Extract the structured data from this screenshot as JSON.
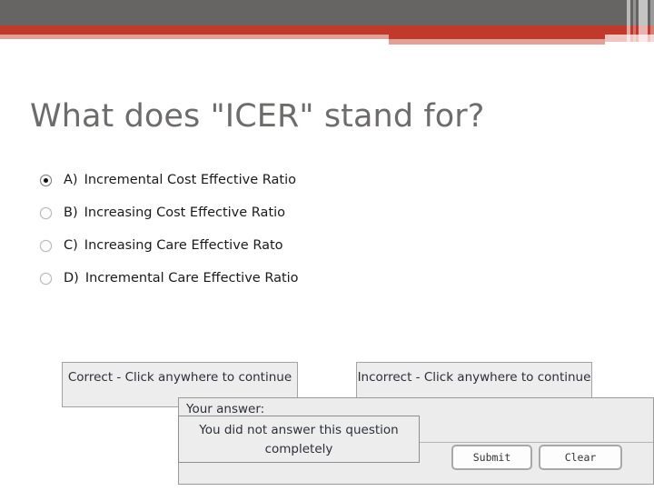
{
  "banner": {
    "colors": {
      "gray": "#666564",
      "red": "#c0392b",
      "pink": "#e1a197",
      "pink_light": "#eec5bf"
    }
  },
  "question": {
    "title": "What does \"ICER\" stand for?",
    "title_color": "#6d6c6b",
    "options": [
      {
        "letter": "A)",
        "text": "Incremental Cost Effective Ratio",
        "selected": true
      },
      {
        "letter": "B)",
        "text": "Increasing Cost Effective Ratio",
        "selected": false
      },
      {
        "letter": "C)",
        "text": "Increasing Care Effective Rato",
        "selected": false
      },
      {
        "letter": "D)",
        "text": "Incremental Care Effective Ratio",
        "selected": false
      }
    ]
  },
  "feedback": {
    "correct": "Correct - Click anywhere to continue",
    "incorrect": "Incorrect - Click anywhere to continue"
  },
  "answer_panel": {
    "label": "Your answer:",
    "message": "You did not answer this question completely",
    "submit_label": "Submit",
    "clear_label": "Clear"
  }
}
